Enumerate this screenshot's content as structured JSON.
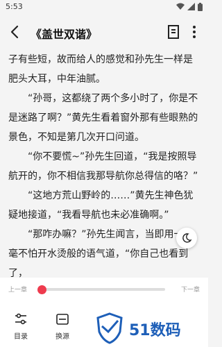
{
  "status": {
    "time": "5:53"
  },
  "header": {
    "title": "《盖世双谐》"
  },
  "content": {
    "paragraphs": [
      {
        "text": "子有些短，故而给人的感觉和孙先生一样是肥头大耳，中年油腻。",
        "indent": false
      },
      {
        "text": "“孙哥，这都绕了两个多小时了，你是不是迷路了啊？”黄先生看着窗外那有些眼熟的景色，不知是第几次开口问道。",
        "indent": true
      },
      {
        "text": "“你不要慌~”孙先生回道，“我是按照导航开的，你不相信我那导航你总得信的咯？”",
        "indent": true
      },
      {
        "text": "“这地方荒山野岭的……”黄先生神色犹疑地接道，“我看导航也未必准确啊。”",
        "indent": true
      },
      {
        "text": "“那咋办嘛？”孙先生闻言，当即用一种毫不怕开水烫般的语气道，“你自己也看到了，",
        "indent": true
      }
    ]
  },
  "reader_panel": {
    "prev_chapter": "上一章",
    "next_chapter": "下一章",
    "progress": 0.0,
    "tools": [
      {
        "label": "目录",
        "icon": "sliders-icon"
      },
      {
        "label": "换源",
        "icon": "switch-source-icon"
      }
    ]
  },
  "watermark": {
    "text": "51数码"
  },
  "colors": {
    "accent": "#ee3b4e",
    "watermark": "#1e5fb8"
  }
}
